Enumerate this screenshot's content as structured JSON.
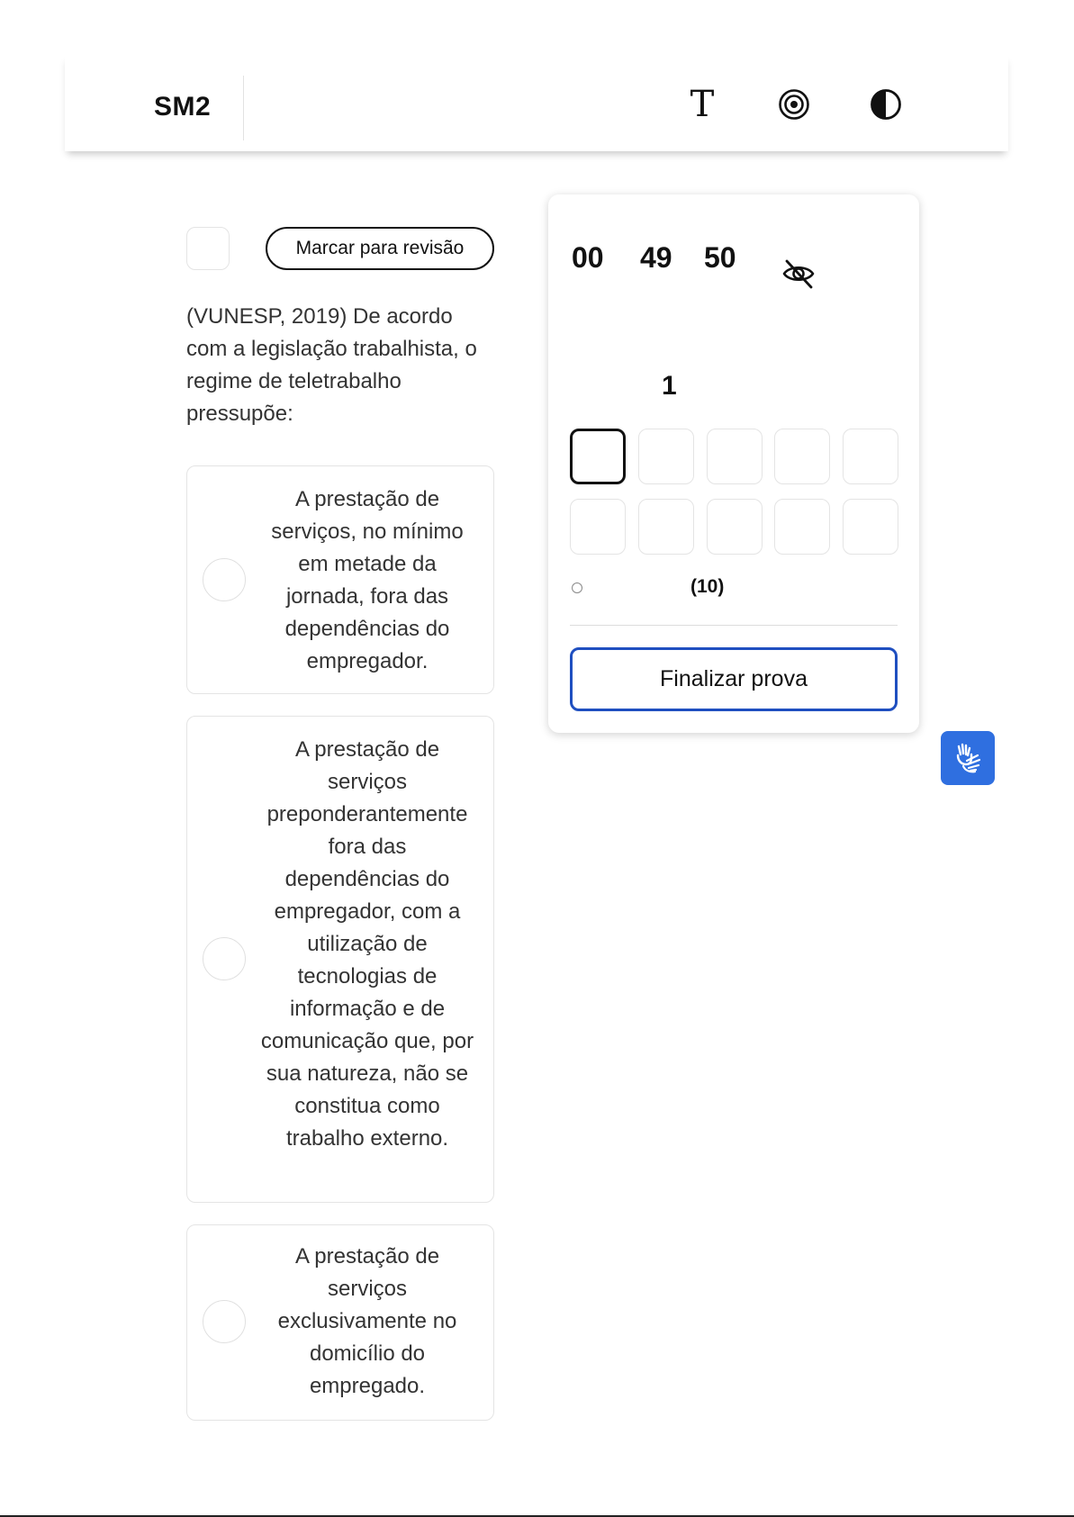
{
  "header": {
    "logo": "SM2",
    "icons": [
      "text-size-icon",
      "focus-target-icon",
      "contrast-icon"
    ],
    "text_size_glyph": "T"
  },
  "question": {
    "review_label": "Marcar para revisão",
    "statement": "(VUNESP, 2019) De acordo com a legislação trabalhista, o regime de teletrabalho pressupõe:",
    "options": [
      {
        "text": "A prestação de serviços, no mínimo em metade da jornada, fora das dependências do empregador."
      },
      {
        "text": "A prestação de serviços preponderantemente fora das dependências do empregador, com a utilização de tecnologias de informação e de comunicação que, por sua natureza, não se constitua como trabalho externo."
      },
      {
        "text": "A prestação de serviços exclusivamente no domicílio do empregado."
      }
    ]
  },
  "panel": {
    "timer": {
      "hours": "00",
      "minutes": "49",
      "seconds": "50"
    },
    "current_question": "1",
    "total_label": "(10)",
    "total_questions": 10,
    "active_question_index": 0,
    "finish_label": "Finalizar prova"
  },
  "colors": {
    "accent": "#1f4fc0",
    "libras": "#2f6fe0",
    "border": "#e4e4e4"
  }
}
